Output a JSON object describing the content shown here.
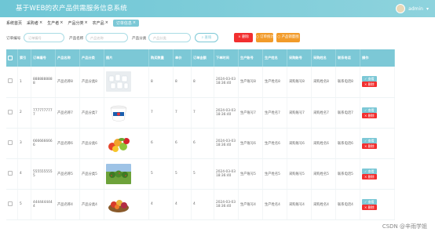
{
  "header": {
    "title": "基于WEB的农产品供需服务信息系统",
    "user": "admin",
    "user_arrow": "▾"
  },
  "tabs": [
    {
      "label": "系统首页",
      "close": ""
    },
    {
      "label": "采购者",
      "close": "×"
    },
    {
      "label": "生产者",
      "close": "×"
    },
    {
      "label": "产品分类",
      "close": "×"
    },
    {
      "label": "农产品",
      "close": "×"
    },
    {
      "label": "订单信息",
      "close": "×"
    }
  ],
  "search": {
    "order_no_label": "订单编号",
    "order_no_placeholder": "订单编号",
    "product_name_label": "产品名称",
    "product_name_placeholder": "产品名称",
    "category_label": "产品分类",
    "category_placeholder": "产品分类",
    "search_btn": "查询"
  },
  "actions": {
    "delete": "× 删除",
    "stat": "○ 订单统计",
    "chart": "○ 产品销量图"
  },
  "table": {
    "columns": [
      "索引",
      "订单编号",
      "产品名称",
      "产品分类",
      "图片",
      "购买数量",
      "单价",
      "订单金额",
      "下单时间",
      "生产账号",
      "生产姓名",
      "采购账号",
      "采购姓名",
      "联系电话",
      "操作"
    ],
    "rows": [
      {
        "idx": "1",
        "order": "8888888888",
        "name": "产品名称8",
        "cat": "产品分类8",
        "img": "img-8",
        "qty": "8",
        "price": "8",
        "total": "8",
        "time": "2024-03-03 18:36:40",
        "pacc": "生产账号8",
        "pname": "生产姓名8",
        "cacc": "采购账号8",
        "cname": "采购姓名8",
        "phone": "联系电话8"
      },
      {
        "idx": "2",
        "order": "7777777777",
        "name": "产品名称7",
        "cat": "产品分类7",
        "img": "img-7",
        "qty": "7",
        "price": "7",
        "total": "7",
        "time": "2024-03-03 18:36:40",
        "pacc": "生产账号7",
        "pname": "生产姓名7",
        "cacc": "采购账号7",
        "cname": "采购姓名7",
        "phone": "联系电话7"
      },
      {
        "idx": "3",
        "order": "6666666666",
        "name": "产品名称6",
        "cat": "产品分类6",
        "img": "img-6",
        "qty": "6",
        "price": "6",
        "total": "6",
        "time": "2024-03-03 18:36:40",
        "pacc": "生产账号6",
        "pname": "生产姓名6",
        "cacc": "采购账号6",
        "cname": "采购姓名6",
        "phone": "联系电话6"
      },
      {
        "idx": "4",
        "order": "5555555555",
        "name": "产品名称5",
        "cat": "产品分类5",
        "img": "img-5",
        "qty": "5",
        "price": "5",
        "total": "5",
        "time": "2024-03-03 18:36:40",
        "pacc": "生产账号5",
        "pname": "生产姓名5",
        "cacc": "采购账号5",
        "cname": "采购姓名5",
        "phone": "联系电话5"
      },
      {
        "idx": "5",
        "order": "4444444444",
        "name": "产品名称4",
        "cat": "产品分类4",
        "img": "img-4",
        "qty": "4",
        "price": "4",
        "total": "4",
        "time": "2024-03-03 18:36:40",
        "pacc": "生产账号4",
        "pname": "生产姓名4",
        "cacc": "采购账号4",
        "cname": "采购姓名4",
        "phone": "联系电话4"
      }
    ],
    "view_btn": "✓ 查看",
    "del_btn": "× 删除"
  },
  "watermark": "CSDN @辛雨学姐"
}
